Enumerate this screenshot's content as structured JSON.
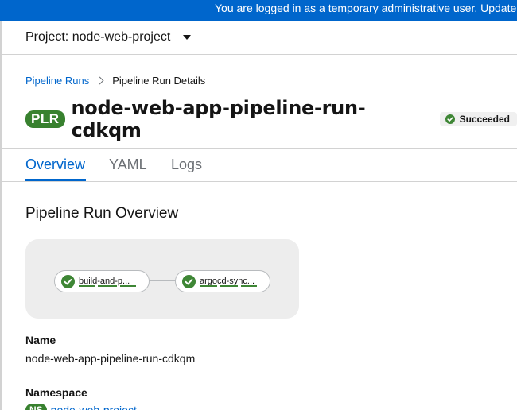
{
  "banner": {
    "text": "You are logged in as a temporary administrative user. Update"
  },
  "project_bar": {
    "label": "Project: node-web-project"
  },
  "breadcrumb": {
    "parent": "Pipeline Runs",
    "current": "Pipeline Run Details"
  },
  "header": {
    "badge": "PLR",
    "title": "node-web-app-pipeline-run-cdkqm",
    "status": "Succeeded"
  },
  "tabs": [
    {
      "label": "Overview",
      "active": true
    },
    {
      "label": "YAML",
      "active": false
    },
    {
      "label": "Logs",
      "active": false
    }
  ],
  "overview": {
    "title": "Pipeline Run Overview",
    "tasks": [
      {
        "label": "build-and-p...",
        "status": "succeeded"
      },
      {
        "label": "argocd-sync...",
        "status": "succeeded"
      }
    ]
  },
  "details": {
    "name_label": "Name",
    "name_value": "node-web-app-pipeline-run-cdkqm",
    "namespace_label": "Namespace",
    "namespace_badge": "NS",
    "namespace_value": "node-web-project"
  },
  "colors": {
    "accent": "#0066cc",
    "success": "#3e8635",
    "badge": "#38812f"
  }
}
